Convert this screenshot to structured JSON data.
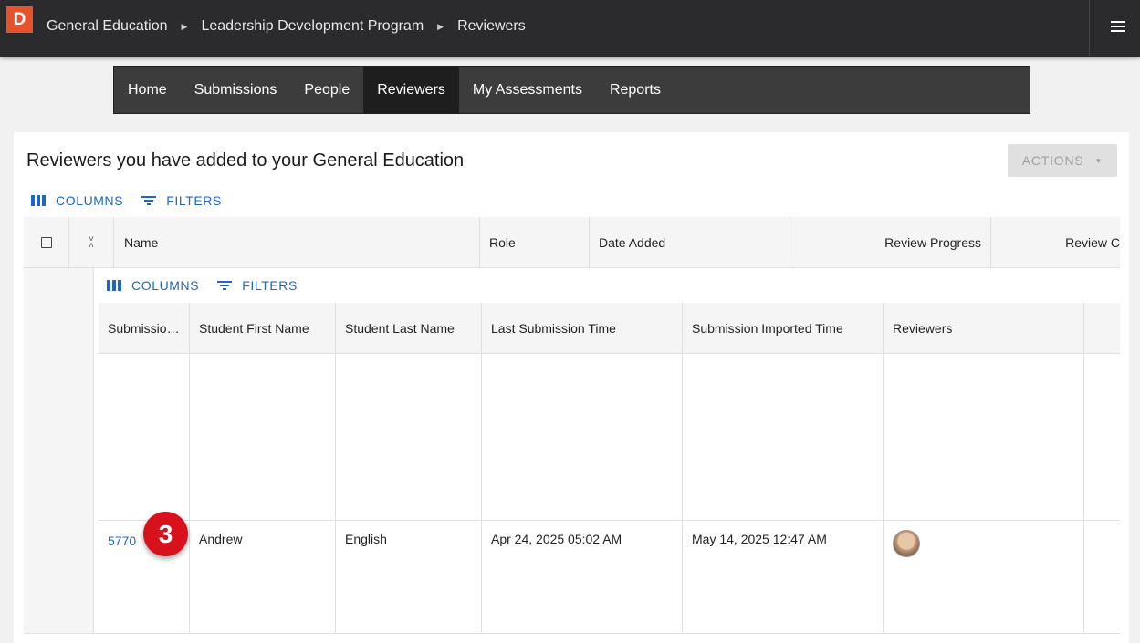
{
  "app": {
    "logo_letter": "D",
    "accent": "#e5532d"
  },
  "breadcrumb": [
    "General Education",
    "Leadership Development Program",
    "Reviewers"
  ],
  "nav": {
    "items": [
      {
        "label": "Home"
      },
      {
        "label": "Submissions"
      },
      {
        "label": "People"
      },
      {
        "label": "Reviewers",
        "active": true
      },
      {
        "label": "My Assessments"
      },
      {
        "label": "Reports"
      }
    ]
  },
  "page": {
    "title": "Reviewers you have added to your General Education",
    "actions_label": "ACTIONS"
  },
  "toolbar": {
    "columns_label": "COLUMNS",
    "filters_label": "FILTERS"
  },
  "outer_table": {
    "columns": [
      "Name",
      "Role",
      "Date Added",
      "Review Progress",
      "Review C"
    ]
  },
  "inner_table": {
    "columns": [
      "Submissio…",
      "Student First Name",
      "Student Last Name",
      "Last Submission Time",
      "Submission Imported Time",
      "Reviewers"
    ],
    "rows": [
      {
        "submission_id": "5770",
        "first_name": "Andrew",
        "last_name": "English",
        "last_submission_time": "Apr 24, 2025 05:02 AM",
        "imported_time": "May 14, 2025 12:47 AM",
        "reviewer_avatar": "avatar-icon"
      }
    ]
  },
  "step_badge": "3"
}
